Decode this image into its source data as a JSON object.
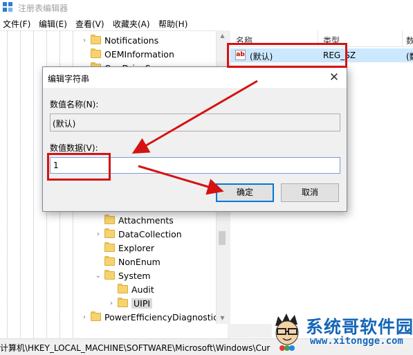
{
  "window": {
    "title": "注册表编辑器",
    "app_icon": "regedit-icon"
  },
  "menu": [
    "文件(F)",
    "编辑(E)",
    "查看(V)",
    "收藏夹(A)",
    "帮助(H)"
  ],
  "tree": {
    "items": [
      {
        "label": "Notifications",
        "expander": "›"
      },
      {
        "label": "OEMInformation",
        "expander": ""
      },
      {
        "label": "OneDriveSamps",
        "expander": ""
      },
      {
        "label": "Attachments",
        "expander": ""
      },
      {
        "label": "DataCollection",
        "expander": "›"
      },
      {
        "label": "Explorer",
        "expander": ""
      },
      {
        "label": "NonEnum",
        "expander": ""
      },
      {
        "label": "System",
        "expander": "⌄"
      },
      {
        "label": "Audit",
        "expander": ""
      },
      {
        "label": "UIPI",
        "expander": "›"
      },
      {
        "label": "PowerEfficiencyDiagnostics",
        "expander": "›"
      }
    ]
  },
  "list": {
    "columns": [
      "名称",
      "类型",
      "数"
    ],
    "rows": [
      {
        "name": "(默认)",
        "type": "REG_SZ",
        "data": "(数"
      }
    ]
  },
  "dialog": {
    "title": "编辑字符串",
    "name_label": "数值名称(N):",
    "name_value": "(默认)",
    "data_label": "数值数据(V):",
    "data_value": "1",
    "ok_label": "确定",
    "cancel_label": "取消",
    "close_glyph": "✕"
  },
  "statusbar": {
    "path": "计算机\\HKEY_LOCAL_MACHINE\\SOFTWARE\\Microsoft\\Windows\\Cur"
  },
  "watermark": {
    "brand": "系统哥软件园",
    "url": "www.xitongge.com"
  },
  "colors": {
    "annotation_red": "#d41313",
    "selection_blue": "#cce8ff",
    "default_button_border": "#0078d7",
    "folder_yellow": "#f7d36e",
    "brand_blue": "#1466b8"
  }
}
